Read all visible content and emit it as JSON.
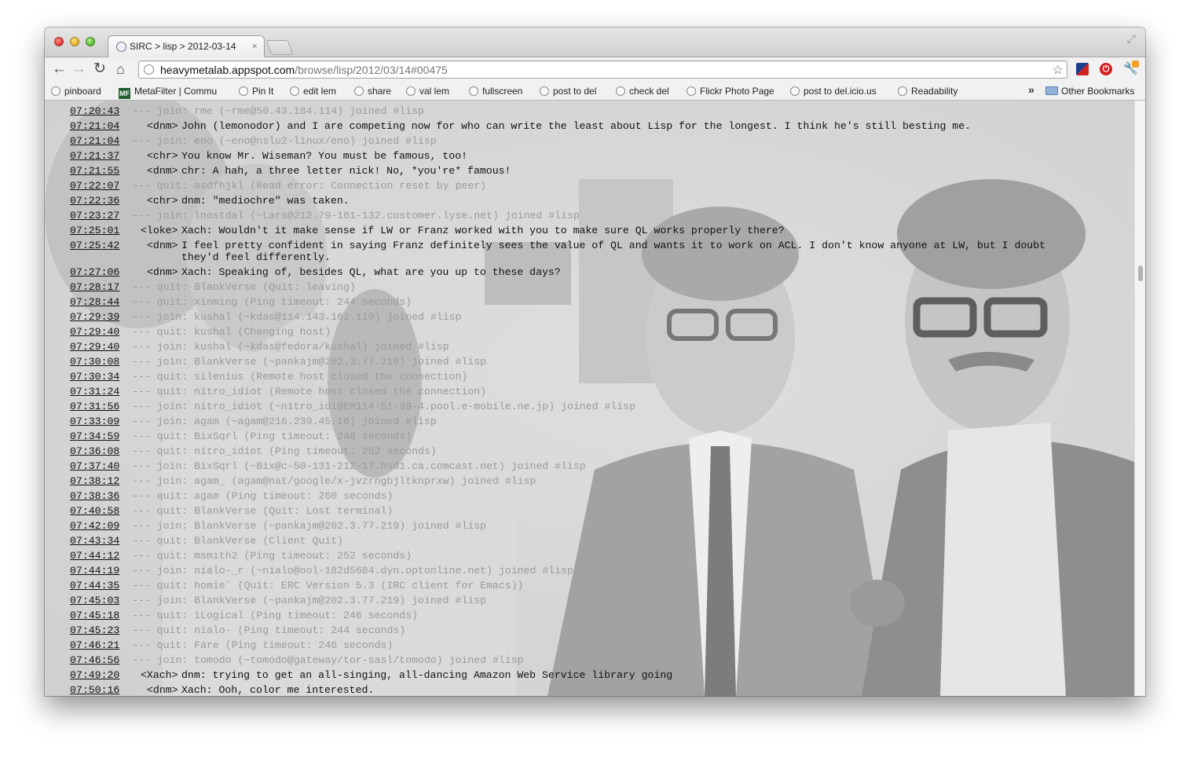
{
  "browser": {
    "tab_title": "SIRC > lisp > 2012-03-14",
    "tab_close": "×",
    "url_host": "heavymetalab.appspot.com",
    "url_path": "/browse/lisp/2012/03/14#00475"
  },
  "bookmarks": {
    "items": [
      {
        "label": "pinboard",
        "icon": "globe-icon"
      },
      {
        "label": "MetaFilter | Commu",
        "icon": "metafilter-icon"
      },
      {
        "label": "Pin It",
        "icon": "globe-icon"
      },
      {
        "label": "edit lem",
        "icon": "globe-icon"
      },
      {
        "label": "share",
        "icon": "globe-icon"
      },
      {
        "label": "val lem",
        "icon": "globe-icon"
      },
      {
        "label": "fullscreen",
        "icon": "globe-icon"
      },
      {
        "label": "post to del",
        "icon": "globe-icon"
      },
      {
        "label": "check del",
        "icon": "globe-icon"
      },
      {
        "label": "Flickr Photo Page",
        "icon": "globe-icon"
      },
      {
        "label": "post to del.icio.us",
        "icon": "globe-icon"
      },
      {
        "label": "Readability",
        "icon": "globe-icon"
      }
    ],
    "overflow": "»",
    "other": "Other Bookmarks"
  },
  "log": [
    {
      "time": "07:20:43",
      "kind": "event",
      "text": "--- join: rme (~rme@50.43.184.114) joined #lisp"
    },
    {
      "time": "07:21:04",
      "kind": "msg",
      "nick": "<dnm>",
      "text": "John (lemonodor) and I are competing now for who can write the least about Lisp for the longest. I think he's still besting me."
    },
    {
      "time": "07:21:04",
      "kind": "event",
      "text": "--- join: eno (~eno@nslu2-linux/eno) joined #lisp"
    },
    {
      "time": "07:21:37",
      "kind": "msg",
      "nick": "<chr>",
      "text": "You know Mr. Wiseman? You must be famous, too!"
    },
    {
      "time": "07:21:55",
      "kind": "msg",
      "nick": "<dnm>",
      "text": "chr: A hah, a three letter nick! No, *you're* famous!"
    },
    {
      "time": "07:22:07",
      "kind": "event",
      "text": "--- quit: asdfhjkl (Read error: Connection reset by peer)"
    },
    {
      "time": "07:22:36",
      "kind": "msg",
      "nick": "<chr>",
      "text": "dnm: \"mediochre\" was taken."
    },
    {
      "time": "07:23:27",
      "kind": "event",
      "text": "--- join: lnostdal (~Lars@212.79-161-132.customer.lyse.net) joined #lisp"
    },
    {
      "time": "07:25:01",
      "kind": "msg",
      "nick": "<loke>",
      "text": "Xach: Wouldn't it make sense if LW or Franz worked with you to make sure QL works properly there?"
    },
    {
      "time": "07:25:42",
      "kind": "msg",
      "nick": "<dnm>",
      "text": "I feel pretty confident in saying Franz definitely sees the value of QL and wants it to work on ACL. I don't know anyone at LW, but I doubt they'd feel differently.",
      "wrap": true
    },
    {
      "time": "07:27:06",
      "kind": "msg",
      "nick": "<dnm>",
      "text": "Xach: Speaking of, besides QL, what are you up to these days?"
    },
    {
      "time": "07:28:17",
      "kind": "event",
      "text": "--- quit: BlankVerse (Quit: leaving)"
    },
    {
      "time": "07:28:44",
      "kind": "event",
      "text": "--- quit: xinming (Ping timeout: 244 seconds)"
    },
    {
      "time": "07:29:39",
      "kind": "event",
      "text": "--- join: kushal (~kdas@114.143.162.110) joined #lisp"
    },
    {
      "time": "07:29:40",
      "kind": "event",
      "text": "--- quit: kushal (Changing host)"
    },
    {
      "time": "07:29:40",
      "kind": "event",
      "text": "--- join: kushal (~kdas@fedora/kushal) joined #lisp"
    },
    {
      "time": "07:30:08",
      "kind": "event",
      "text": "--- join: BlankVerse (~pankajm@202.3.77.219) joined #lisp"
    },
    {
      "time": "07:30:34",
      "kind": "event",
      "text": "--- quit: silenius (Remote host closed the connection)"
    },
    {
      "time": "07:31:24",
      "kind": "event",
      "text": "--- quit: nitro_idiot (Remote host closed the connection)"
    },
    {
      "time": "07:31:56",
      "kind": "event",
      "text": "--- join: nitro_idiot (~nitro_idi@EM114-51-39-4.pool.e-mobile.ne.jp) joined #lisp"
    },
    {
      "time": "07:33:09",
      "kind": "event",
      "text": "--- join: agam (~agam@216.239.45.16) joined #lisp"
    },
    {
      "time": "07:34:59",
      "kind": "event",
      "text": "--- quit: BixSqrl (Ping timeout: 246 seconds)"
    },
    {
      "time": "07:36:08",
      "kind": "event",
      "text": "--- quit: nitro_idiot (Ping timeout: 252 seconds)"
    },
    {
      "time": "07:37:40",
      "kind": "event",
      "text": "--- join: BixSqrl (~Bix@c-50-131-212-17.hsd1.ca.comcast.net) joined #lisp"
    },
    {
      "time": "07:38:12",
      "kind": "event",
      "text": "--- join: agam_ (agam@nat/google/x-jvzrngbjltknprxw) joined #lisp"
    },
    {
      "time": "07:38:36",
      "kind": "event",
      "text": "--- quit: agam (Ping timeout: 260 seconds)"
    },
    {
      "time": "07:40:58",
      "kind": "event",
      "text": "--- quit: BlankVerse (Quit: Lost terminal)"
    },
    {
      "time": "07:42:09",
      "kind": "event",
      "text": "--- join: BlankVerse (~pankajm@202.3.77.219) joined #lisp"
    },
    {
      "time": "07:43:34",
      "kind": "event",
      "text": "--- quit: BlankVerse (Client Quit)"
    },
    {
      "time": "07:44:12",
      "kind": "event",
      "text": "--- quit: msmith2 (Ping timeout: 252 seconds)"
    },
    {
      "time": "07:44:19",
      "kind": "event",
      "text": "--- join: nialo-_r (~nialo@ool-182d5684.dyn.optonline.net) joined #lisp"
    },
    {
      "time": "07:44:35",
      "kind": "event",
      "text": "--- quit: homie` (Quit: ERC Version 5.3 (IRC client for Emacs))"
    },
    {
      "time": "07:45:03",
      "kind": "event",
      "text": "--- join: BlankVerse (~pankajm@202.3.77.219) joined #lisp"
    },
    {
      "time": "07:45:18",
      "kind": "event",
      "text": "--- quit: iLogical (Ping timeout: 246 seconds)"
    },
    {
      "time": "07:45:23",
      "kind": "event",
      "text": "--- quit: nialo- (Ping timeout: 244 seconds)"
    },
    {
      "time": "07:46:21",
      "kind": "event",
      "text": "--- quit: Fare (Ping timeout: 246 seconds)"
    },
    {
      "time": "07:46:56",
      "kind": "event",
      "text": "--- join: tomodo (~tomodo@gateway/tor-sasl/tomodo) joined #lisp"
    },
    {
      "time": "07:49:20",
      "kind": "msg",
      "nick": "<Xach>",
      "text": "dnm: trying to get an all-singing, all-dancing Amazon Web Service library going"
    },
    {
      "time": "07:50:16",
      "kind": "msg",
      "nick": "<dnm>",
      "text": "Xach: Ooh, color me interested."
    }
  ]
}
